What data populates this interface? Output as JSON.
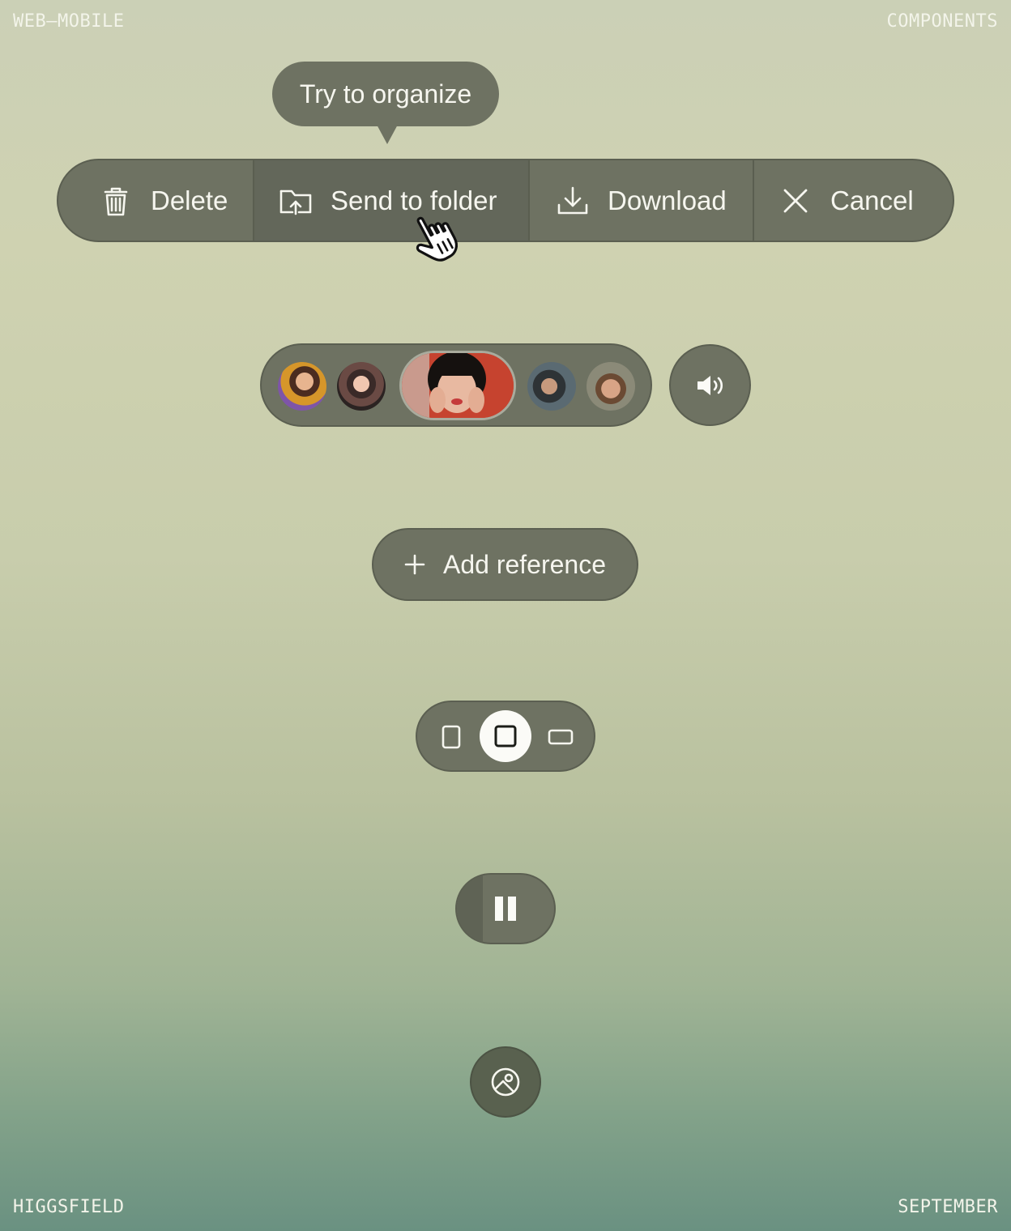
{
  "corners": {
    "top_left": "WEB–MOBILE",
    "top_right": "COMPONENTS",
    "bottom_left": "HIGGSFIELD",
    "bottom_right": "SEPTEMBER"
  },
  "tooltip": {
    "text": "Try to organize"
  },
  "action_bar": {
    "delete_label": "Delete",
    "send_to_folder_label": "Send to folder",
    "download_label": "Download",
    "cancel_label": "Cancel",
    "hovered": "send_to_folder"
  },
  "avatar_picker": {
    "count": 5,
    "selected_index": 2,
    "sound_icon": "speaker-icon"
  },
  "add_reference": {
    "label": "Add reference",
    "icon": "plus-icon"
  },
  "aspect_ratio": {
    "options": [
      "portrait",
      "square",
      "landscape"
    ],
    "selected": "square"
  },
  "playback": {
    "icon": "pause-icon"
  },
  "image_button": {
    "icon": "image-icon"
  },
  "colors": {
    "pill_bg": "#6e7262",
    "pill_border": "#5b5f51",
    "text": "#f6f6ef",
    "accent_white": "#fbfbf7"
  }
}
